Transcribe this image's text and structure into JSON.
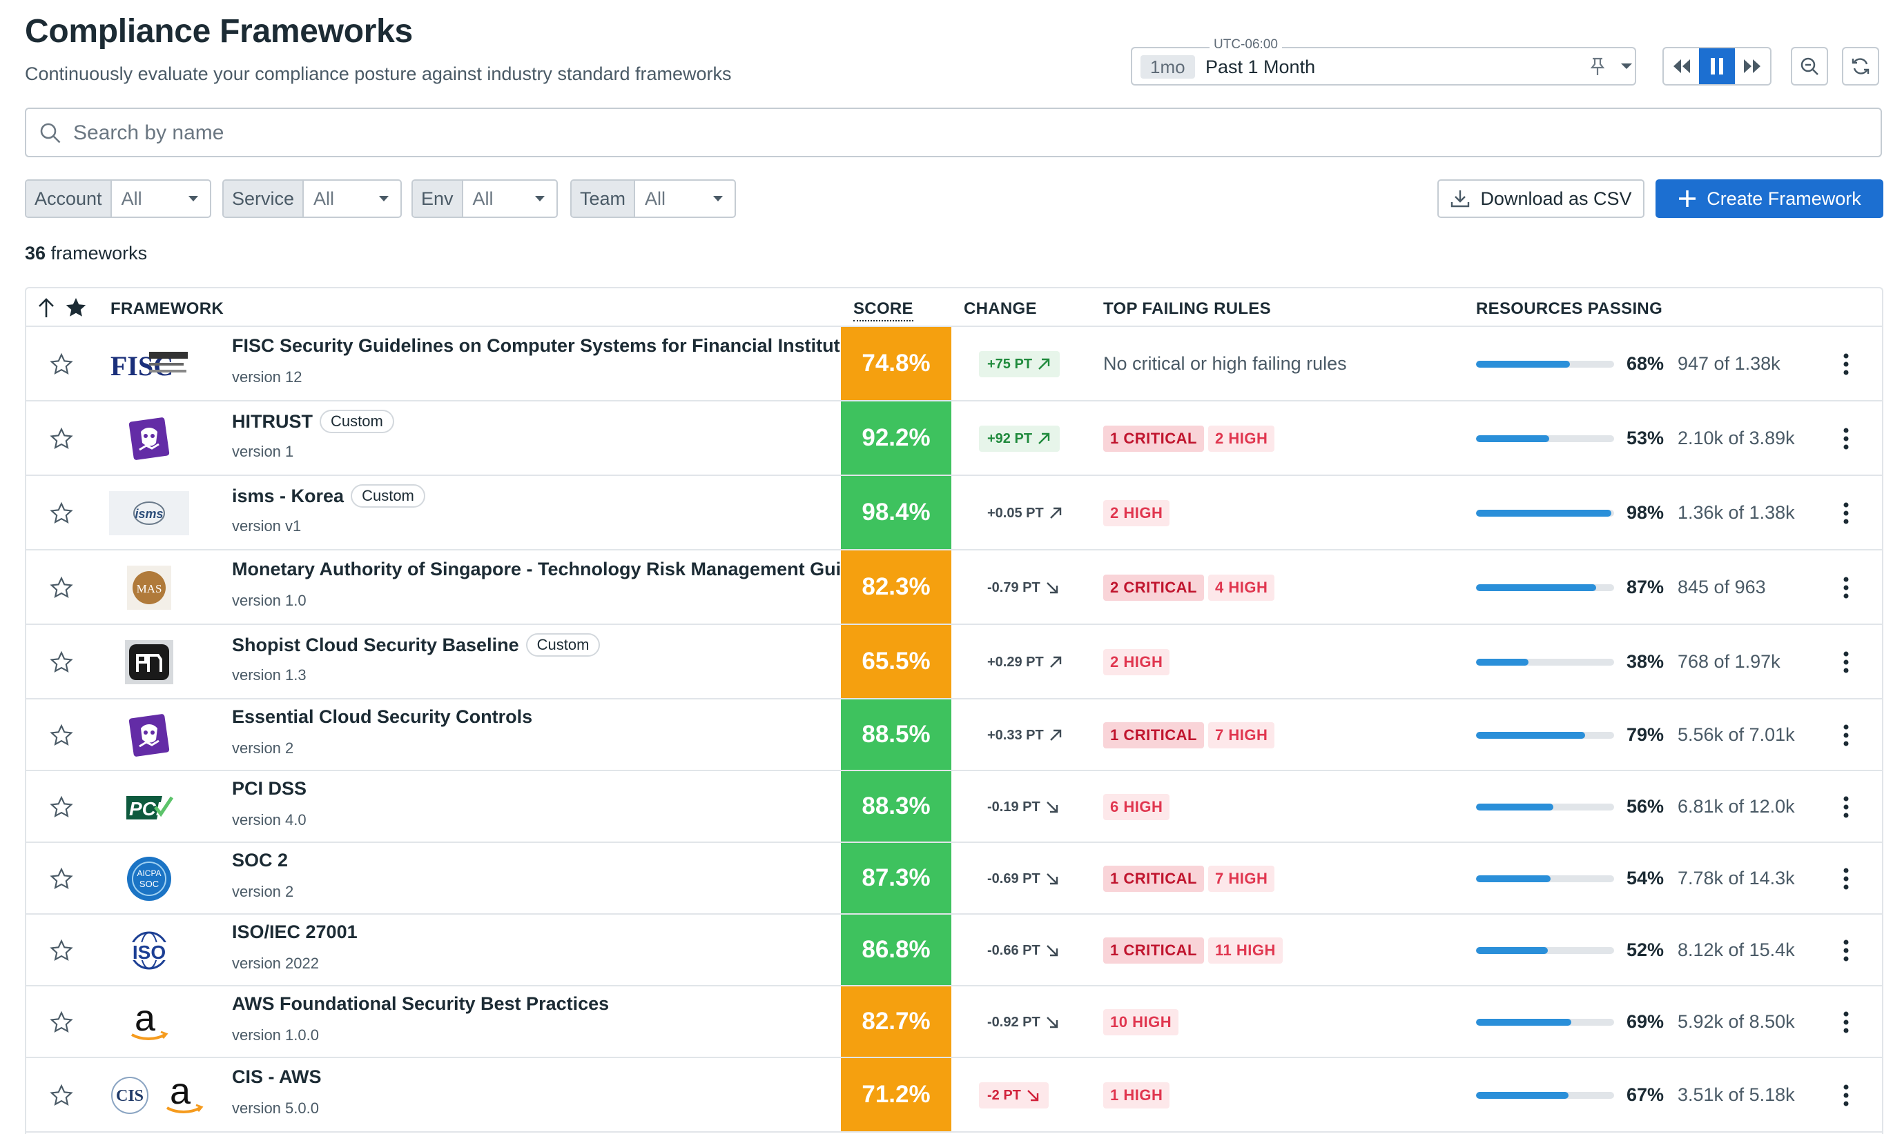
{
  "page": {
    "title": "Compliance Frameworks",
    "subtitle": "Continuously evaluate your compliance posture against industry standard frameworks"
  },
  "time": {
    "timezone": "UTC-06:00",
    "chip": "1mo",
    "value": "Past 1 Month"
  },
  "search": {
    "placeholder": "Search by name"
  },
  "filters": [
    {
      "label": "Account",
      "value": "All"
    },
    {
      "label": "Service",
      "value": "All"
    },
    {
      "label": "Env",
      "value": "All"
    },
    {
      "label": "Team",
      "value": "All"
    }
  ],
  "actions": {
    "download": "Download as CSV",
    "create": "Create Framework"
  },
  "summary": {
    "count": "36",
    "count_suffix": "frameworks"
  },
  "table": {
    "headers": {
      "framework": "FRAMEWORK",
      "score": "SCORE",
      "change": "CHANGE",
      "rules": "TOP FAILING RULES",
      "resources": "RESOURCES PASSING"
    },
    "custom_label": "Custom",
    "colors": {
      "orange": "#f5a00f",
      "green": "#3ec25e"
    },
    "rows": [
      {
        "name": "FISC Security Guidelines on Computer Systems for Financial Institutio",
        "custom": false,
        "version": "version 12",
        "logo": "fisc-logo",
        "score": "74.8%",
        "score_color": "orange",
        "change": "+75 PT",
        "dir": "up",
        "change_style": "pos-big",
        "no_rules": "No critical or high failing rules",
        "critical": "",
        "high": "",
        "pct_value": 68,
        "pct": "68%",
        "of": "947 of 1.38k"
      },
      {
        "name": "HITRUST",
        "custom": true,
        "version": "version 1",
        "logo": "datadog-logo",
        "score": "92.2%",
        "score_color": "green",
        "change": "+92 PT",
        "dir": "up",
        "change_style": "pos-big",
        "no_rules": "",
        "critical": "1 CRITICAL",
        "high": "2 HIGH",
        "pct_value": 53,
        "pct": "53%",
        "of": "2.10k of 3.89k"
      },
      {
        "name": "isms - Korea",
        "custom": true,
        "version": "version v1",
        "logo": "isms-logo",
        "score": "98.4%",
        "score_color": "green",
        "change": "+0.05 PT",
        "dir": "up",
        "change_style": "",
        "no_rules": "",
        "critical": "",
        "high": "2 HIGH",
        "pct_value": 98,
        "pct": "98%",
        "of": "1.36k of 1.38k"
      },
      {
        "name": "Monetary Authority of Singapore - Technology Risk Management Guic",
        "custom": false,
        "version": "version 1.0",
        "logo": "mas-logo",
        "score": "82.3%",
        "score_color": "orange",
        "change": "-0.79 PT",
        "dir": "down",
        "change_style": "",
        "no_rules": "",
        "critical": "2 CRITICAL",
        "high": "4 HIGH",
        "pct_value": 87,
        "pct": "87%",
        "of": "845 of 963"
      },
      {
        "name": "Shopist Cloud Security Baseline",
        "custom": true,
        "version": "version 1.3",
        "logo": "shopist-logo",
        "score": "65.5%",
        "score_color": "orange",
        "change": "+0.29 PT",
        "dir": "up",
        "change_style": "",
        "no_rules": "",
        "critical": "",
        "high": "2 HIGH",
        "pct_value": 38,
        "pct": "38%",
        "of": "768 of 1.97k"
      },
      {
        "name": "Essential Cloud Security Controls",
        "custom": false,
        "version": "version 2",
        "logo": "datadog-logo",
        "score": "88.5%",
        "score_color": "green",
        "change": "+0.33 PT",
        "dir": "up",
        "change_style": "",
        "no_rules": "",
        "critical": "1 CRITICAL",
        "high": "7 HIGH",
        "pct_value": 79,
        "pct": "79%",
        "of": "5.56k of 7.01k"
      },
      {
        "name": "PCI DSS",
        "custom": false,
        "version": "version 4.0",
        "logo": "pci-logo",
        "score": "88.3%",
        "score_color": "green",
        "change": "-0.19 PT",
        "dir": "down",
        "change_style": "",
        "no_rules": "",
        "critical": "",
        "high": "6 HIGH",
        "pct_value": 56,
        "pct": "56%",
        "of": "6.81k of 12.0k"
      },
      {
        "name": "SOC 2",
        "custom": false,
        "version": "version 2",
        "logo": "soc-logo",
        "score": "87.3%",
        "score_color": "green",
        "change": "-0.69 PT",
        "dir": "down",
        "change_style": "",
        "no_rules": "",
        "critical": "1 CRITICAL",
        "high": "7 HIGH",
        "pct_value": 54,
        "pct": "54%",
        "of": "7.78k of 14.3k"
      },
      {
        "name": "ISO/IEC 27001",
        "custom": false,
        "version": "version 2022",
        "logo": "iso-logo",
        "score": "86.8%",
        "score_color": "green",
        "change": "-0.66 PT",
        "dir": "down",
        "change_style": "",
        "no_rules": "",
        "critical": "1 CRITICAL",
        "high": "11 HIGH",
        "pct_value": 52,
        "pct": "52%",
        "of": "8.12k of 15.4k"
      },
      {
        "name": "AWS Foundational Security Best Practices",
        "custom": false,
        "version": "version 1.0.0",
        "logo": "aws-logo",
        "score": "82.7%",
        "score_color": "orange",
        "change": "-0.92 PT",
        "dir": "down",
        "change_style": "",
        "no_rules": "",
        "critical": "",
        "high": "10 HIGH",
        "pct_value": 69,
        "pct": "69%",
        "of": "5.92k of 8.50k"
      },
      {
        "name": "CIS - AWS",
        "custom": false,
        "version": "version 5.0.0",
        "logo": "cis-aws-logo",
        "score": "71.2%",
        "score_color": "orange",
        "change": "-2 PT",
        "dir": "down",
        "change_style": "neg-big",
        "no_rules": "",
        "critical": "",
        "high": "1 HIGH",
        "pct_value": 67,
        "pct": "67%",
        "of": "3.51k of 5.18k"
      }
    ]
  }
}
